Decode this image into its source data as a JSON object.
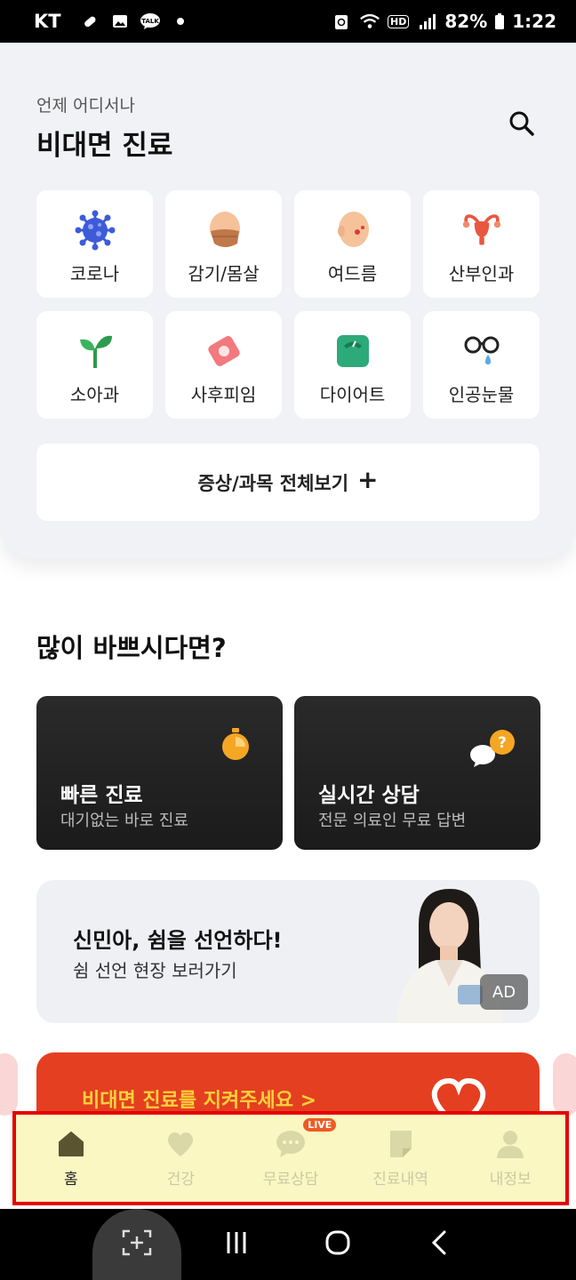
{
  "status_bar": {
    "carrier": "KT",
    "battery": "82%",
    "time": "1:22",
    "hd": "HD"
  },
  "header": {
    "subtitle": "언제 어디서나",
    "title": "비대면 진료",
    "search_icon": "search-icon"
  },
  "categories": [
    {
      "label": "코로나",
      "icon": "virus-icon"
    },
    {
      "label": "감기/몸살",
      "icon": "masked-face-icon"
    },
    {
      "label": "여드름",
      "icon": "acne-face-icon"
    },
    {
      "label": "산부인과",
      "icon": "uterus-icon"
    },
    {
      "label": "소아과",
      "icon": "sprout-icon"
    },
    {
      "label": "사후피임",
      "icon": "pill-pack-icon"
    },
    {
      "label": "다이어트",
      "icon": "scale-icon"
    },
    {
      "label": "인공눈물",
      "icon": "glasses-drop-icon"
    }
  ],
  "view_all": {
    "label": "증상/과목 전체보기",
    "plus": "+"
  },
  "busy_section": {
    "title": "많이 바쁘시다면?",
    "cards": [
      {
        "title": "빠른 진료",
        "subtitle": "대기없는 바로 진료",
        "icon": "stopwatch-icon"
      },
      {
        "title": "실시간 상담",
        "subtitle": "전문 의료인 무료 답변",
        "icon": "chat-question-icon"
      }
    ]
  },
  "ad_banner": {
    "title": "신민아, 쉼을 선언하다!",
    "subtitle": "쉼 선언 현장 보러가기",
    "badge": "AD"
  },
  "promo_banner": {
    "text": "비대면 진료를 지켜주세요 >"
  },
  "bottom_nav": {
    "items": [
      {
        "label": "홈",
        "icon": "home-icon",
        "active": true
      },
      {
        "label": "건강",
        "icon": "heart-icon",
        "active": false
      },
      {
        "label": "무료상담",
        "icon": "chat-icon",
        "active": false,
        "badge": "LIVE"
      },
      {
        "label": "진료내역",
        "icon": "document-icon",
        "active": false
      },
      {
        "label": "내정보",
        "icon": "person-icon",
        "active": false
      }
    ]
  },
  "colors": {
    "accent": "#f39c12",
    "dark_card": "#222222",
    "promo": "#e43f20",
    "promo_text": "#ffd23a",
    "nav_highlight": "#fbf7c3",
    "nav_border": "#e60000",
    "nav_active": "#5a5430"
  }
}
